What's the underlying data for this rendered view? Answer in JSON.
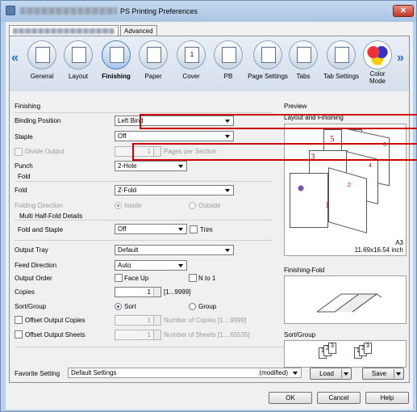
{
  "window": {
    "title": "PS Printing Preferences",
    "close_glyph": "✕"
  },
  "tabs": [
    "",
    "Advanced"
  ],
  "nav": {
    "left_arrow": "«",
    "right_arrow": "»",
    "items": [
      "General",
      "Layout",
      "Finishing",
      "Paper",
      "Cover",
      "PB",
      "Page Settings",
      "Tabs",
      "Tab Settings",
      "Color Mode"
    ],
    "selected": "Finishing",
    "cover_glyph": "1"
  },
  "finishing": {
    "section_label": "Finishing",
    "binding_position": {
      "label": "Binding Position",
      "value": "Left Bind"
    },
    "staple": {
      "label": "Staple",
      "value": "Off"
    },
    "divide_output": {
      "label": "Divide Output",
      "value": "1",
      "unit": "Pages per Section"
    },
    "punch": {
      "label": "Punch",
      "value": "2-Hole"
    },
    "fold_group": "Fold",
    "fold": {
      "label": "Fold",
      "value": "Z-Fold"
    },
    "folding_direction": {
      "label": "Folding Direction",
      "options": [
        "Inside",
        "Outside"
      ],
      "selected": "Inside"
    },
    "multi_half_fold": "Multi Half-Fold Details",
    "fold_and_staple": {
      "label": "Fold and Staple",
      "value": "Off",
      "trim": "Trim"
    }
  },
  "output": {
    "output_tray": {
      "label": "Output Tray",
      "value": "Default"
    },
    "feed_direction": {
      "label": "Feed Direction",
      "value": "Auto"
    },
    "output_order": {
      "label": "Output Order",
      "face_up": "Face Up",
      "n_to_1": "N to 1"
    },
    "copies": {
      "label": "Copies",
      "value": "1",
      "range": "[1...9999]"
    },
    "sort_group": {
      "label": "Sort/Group",
      "options": [
        "Sort",
        "Group"
      ],
      "selected": "Sort"
    },
    "offset_output_copies": {
      "label": "Offset Output Copies",
      "value": "1",
      "unit": "Number of Copies [1....9999]"
    },
    "offset_output_sheets": {
      "label": "Offset Output Sheets",
      "value": "1",
      "unit": "Number of Sheets [1....65535]"
    }
  },
  "preview": {
    "label": "Preview",
    "layout_label": "Layout and Finishing",
    "paper": "A3",
    "paper_size": "11.69x16.54 inch",
    "sheet_numbers": [
      "5",
      "3",
      "1"
    ],
    "sheet_page_numbers": [
      "6",
      "4",
      "2"
    ],
    "finishing_fold_label": "Finishing-Fold",
    "sort_group_label": "Sort/Group",
    "stack_numbers": [
      "1",
      "2",
      "3"
    ]
  },
  "favorite": {
    "label": "Favorite Setting",
    "value": "Default Settings",
    "modified": "(modified)",
    "load": "Load",
    "save": "Save"
  },
  "buttons": {
    "ok": "OK",
    "cancel": "Cancel",
    "help": "Help"
  },
  "colors": {
    "callout": "#cc0000",
    "accent": "#2b6cc4"
  }
}
